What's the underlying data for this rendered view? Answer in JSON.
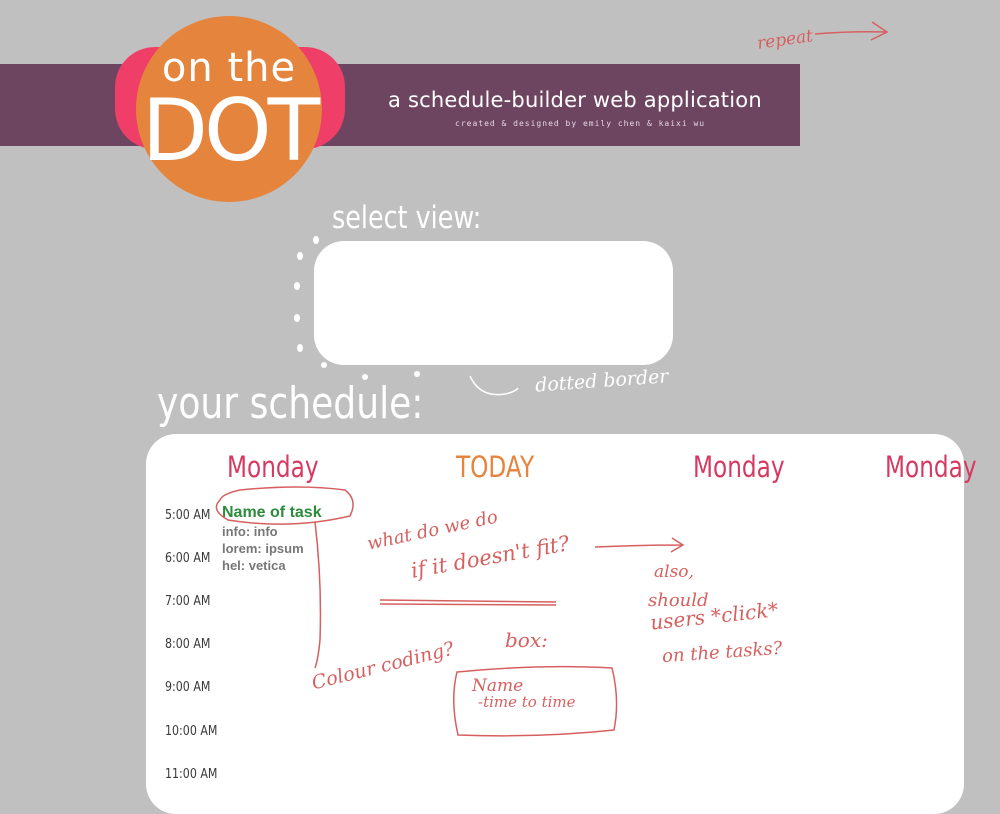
{
  "header": {
    "logo_top": "on the",
    "logo_main": "DOT",
    "tagline": "a schedule-builder web application",
    "credit": "created & designed by emily chen & kaixi wu"
  },
  "select_view": {
    "label": "select view:"
  },
  "schedule": {
    "label": "your schedule:",
    "days": [
      "Monday",
      "TODAY",
      "Monday",
      "Monday"
    ],
    "times": [
      "5:00 AM",
      "6:00 AM",
      "7:00 AM",
      "8:00 AM",
      "9:00 AM",
      "10:00 AM",
      "11:00 AM"
    ],
    "task": {
      "name": "Name of task",
      "lines": [
        "info: info",
        "lorem: ipsum",
        "hel: vetica"
      ]
    }
  },
  "annotations": {
    "repeat": "repeat",
    "dotted_border": "dotted border",
    "doesnt_fit_1": "what do we do",
    "doesnt_fit_2": "if it doesn't fit?",
    "colour_coding": "Colour coding?",
    "box": "box:",
    "box_name": "Name",
    "box_time": "-time to time",
    "also_1": "also,",
    "also_2": "should",
    "also_3": "users *click*",
    "also_4": "on the tasks?"
  },
  "colors": {
    "header_band": "#6e4560",
    "logo_orange": "#e5843c",
    "logo_ring": "#ef3f68",
    "day_pink": "#d63a63",
    "today_orange": "#e5843c",
    "task_green": "#2e8b3c",
    "ink": "#d6605f"
  }
}
